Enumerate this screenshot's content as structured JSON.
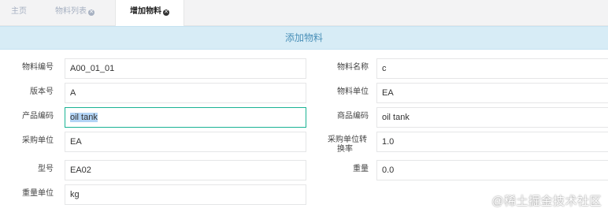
{
  "tabs": [
    {
      "label": "主页",
      "closable": false,
      "active": false
    },
    {
      "label": "物料列表",
      "closable": true,
      "active": false
    },
    {
      "label": "增加物料",
      "closable": true,
      "active": true
    }
  ],
  "section_title": "添加物料",
  "form": {
    "left": [
      {
        "label": "物料编号",
        "value": "A00_01_01"
      },
      {
        "label": "版本号",
        "value": "A"
      },
      {
        "label": "产品编码",
        "value": "oil tank"
      },
      {
        "label": "采购单位",
        "value": "EA"
      },
      {
        "label": "型号",
        "value": "EA02"
      },
      {
        "label": "重量单位",
        "value": "kg"
      }
    ],
    "right": [
      {
        "label": "物料名称",
        "value": "c"
      },
      {
        "label": "物料单位",
        "value": "EA"
      },
      {
        "label": "商品编码",
        "value": "oil tank"
      },
      {
        "label_line1": "采购单位转",
        "label_line2": "换率",
        "value": "1.0"
      },
      {
        "label": "重量",
        "value": "0.0"
      }
    ]
  },
  "watermark": "@稀土掘金技术社区"
}
